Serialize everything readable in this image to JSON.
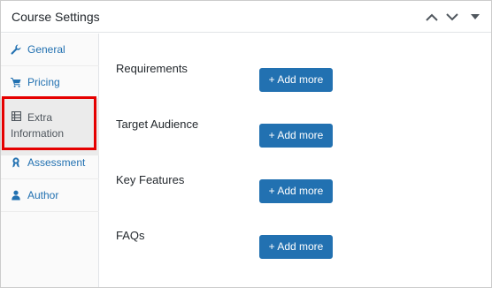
{
  "panel": {
    "title": "Course Settings",
    "collapse_up_icon": "chevron-up-icon",
    "collapse_down_icon": "chevron-down-icon",
    "toggle_icon": "caret-down-icon"
  },
  "tabs": [
    {
      "label": "General",
      "icon": "wrench-icon",
      "active": false
    },
    {
      "label": "Pricing",
      "icon": "cart-icon",
      "active": false
    },
    {
      "label": "Extra Information",
      "icon": "table-icon",
      "active": true
    },
    {
      "label": "Assessment",
      "icon": "award-icon",
      "active": false
    },
    {
      "label": "Author",
      "icon": "user-icon",
      "active": false
    }
  ],
  "fields": [
    {
      "label": "Requirements",
      "button": "+ Add more"
    },
    {
      "label": "Target Audience",
      "button": "+ Add more"
    },
    {
      "label": "Key Features",
      "button": "+ Add more"
    },
    {
      "label": "FAQs",
      "button": "+ Add more"
    }
  ],
  "colors": {
    "accent": "#2271b1",
    "highlight": "#e50000",
    "sidebar_bg": "#fafafa",
    "active_tab_bg": "#ebebeb"
  }
}
